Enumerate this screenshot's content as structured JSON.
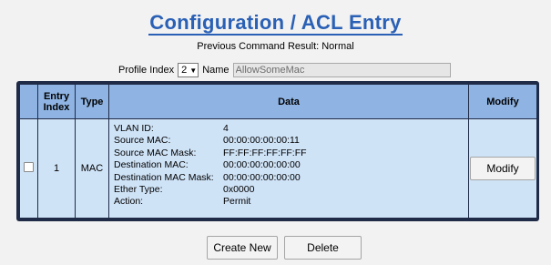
{
  "header": {
    "title": "Configuration / ACL Entry",
    "previous_result": "Previous Command Result: Normal"
  },
  "profile": {
    "index_label": "Profile Index",
    "index_value": "2",
    "name_label": "Name",
    "name_value": "AllowSomeMac"
  },
  "table": {
    "headers": {
      "entry_index": "Entry Index",
      "type": "Type",
      "data": "Data",
      "modify": "Modify"
    },
    "rows": [
      {
        "entry_index": "1",
        "type": "MAC",
        "fields": [
          {
            "label": "VLAN ID:",
            "value": "4"
          },
          {
            "label": "Source MAC:",
            "value": "00:00:00:00:00:11"
          },
          {
            "label": "Source MAC Mask:",
            "value": "FF:FF:FF:FF:FF:FF"
          },
          {
            "label": "Destination MAC:",
            "value": "00:00:00:00:00:00"
          },
          {
            "label": "Destination MAC Mask:",
            "value": "00:00:00:00:00:00"
          },
          {
            "label": "Ether Type:",
            "value": "0x0000"
          },
          {
            "label": "Action:",
            "value": "Permit"
          }
        ],
        "modify_label": "Modify"
      }
    ]
  },
  "actions": {
    "create_new": "Create New",
    "delete": "Delete"
  }
}
